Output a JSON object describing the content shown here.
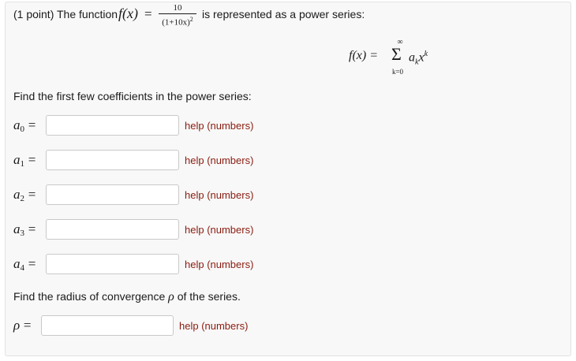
{
  "problem": {
    "points": "(1 point)",
    "lead": "The function",
    "func": "f(x)",
    "eq": "=",
    "numerator": "10",
    "denominator": "(1+10x)",
    "denominator_exp": "2",
    "tail": "is represented as a power series:",
    "series_lhs": "f(x) =",
    "sum_symbol": "Σ",
    "sum_upper": "∞",
    "sum_lower": "k=0",
    "sum_term": "a",
    "sum_term_sub": "k",
    "sum_term_x": "x",
    "sum_term_sup": "k"
  },
  "coefficients_prompt": "Find the first few coefficients in the power series:",
  "coefficients": [
    {
      "sym": "a",
      "sub": "0",
      "eq": "=",
      "value": "",
      "help": "help (numbers)"
    },
    {
      "sym": "a",
      "sub": "1",
      "eq": "=",
      "value": "",
      "help": "help (numbers)"
    },
    {
      "sym": "a",
      "sub": "2",
      "eq": "=",
      "value": "",
      "help": "help (numbers)"
    },
    {
      "sym": "a",
      "sub": "3",
      "eq": "=",
      "value": "",
      "help": "help (numbers)"
    },
    {
      "sym": "a",
      "sub": "4",
      "eq": "=",
      "value": "",
      "help": "help (numbers)"
    }
  ],
  "radius": {
    "prompt_before": "Find the radius of convergence",
    "symbol": "ρ",
    "prompt_after": "of the series.",
    "eq": "=",
    "value": "",
    "help": "help (numbers)"
  },
  "colors": {
    "help_link": "#8a1c0f",
    "panel": "#f8f8f8"
  }
}
